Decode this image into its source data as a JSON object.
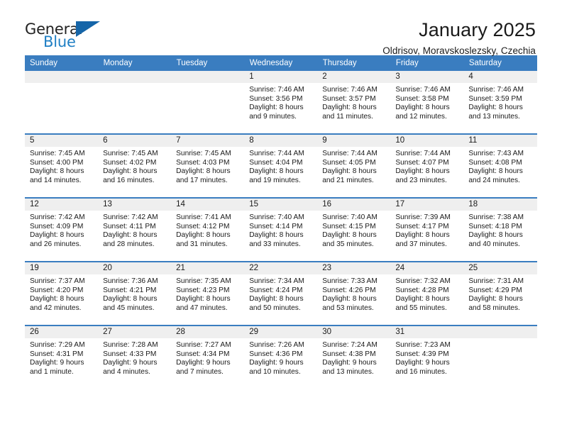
{
  "brand": {
    "name_top": "General",
    "name_bottom": "Blue",
    "accent_color": "#1f7fc4",
    "triangle_color": "#1565a8"
  },
  "header": {
    "title": "January 2025",
    "subtitle": "Oldrisov, Moravskoslezsky, Czechia"
  },
  "theme": {
    "header_row_bg": "#3a7dc0",
    "daynum_bg": "#efefef",
    "cell_bg": "#ffffff",
    "text_color": "#1a1a1a"
  },
  "weekday_headers": [
    "Sunday",
    "Monday",
    "Tuesday",
    "Wednesday",
    "Thursday",
    "Friday",
    "Saturday"
  ],
  "labels": {
    "sunrise_prefix": "Sunrise:",
    "sunset_prefix": "Sunset:",
    "daylight_prefix": "Daylight:"
  },
  "weeks": [
    [
      {
        "day": "",
        "empty": true
      },
      {
        "day": "",
        "empty": true
      },
      {
        "day": "",
        "empty": true
      },
      {
        "day": "1",
        "sunrise": "Sunrise: 7:46 AM",
        "sunset": "Sunset: 3:56 PM",
        "daylight_1": "Daylight: 8 hours",
        "daylight_2": "and 9 minutes."
      },
      {
        "day": "2",
        "sunrise": "Sunrise: 7:46 AM",
        "sunset": "Sunset: 3:57 PM",
        "daylight_1": "Daylight: 8 hours",
        "daylight_2": "and 11 minutes."
      },
      {
        "day": "3",
        "sunrise": "Sunrise: 7:46 AM",
        "sunset": "Sunset: 3:58 PM",
        "daylight_1": "Daylight: 8 hours",
        "daylight_2": "and 12 minutes."
      },
      {
        "day": "4",
        "sunrise": "Sunrise: 7:46 AM",
        "sunset": "Sunset: 3:59 PM",
        "daylight_1": "Daylight: 8 hours",
        "daylight_2": "and 13 minutes."
      }
    ],
    [
      {
        "day": "5",
        "sunrise": "Sunrise: 7:45 AM",
        "sunset": "Sunset: 4:00 PM",
        "daylight_1": "Daylight: 8 hours",
        "daylight_2": "and 14 minutes."
      },
      {
        "day": "6",
        "sunrise": "Sunrise: 7:45 AM",
        "sunset": "Sunset: 4:02 PM",
        "daylight_1": "Daylight: 8 hours",
        "daylight_2": "and 16 minutes."
      },
      {
        "day": "7",
        "sunrise": "Sunrise: 7:45 AM",
        "sunset": "Sunset: 4:03 PM",
        "daylight_1": "Daylight: 8 hours",
        "daylight_2": "and 17 minutes."
      },
      {
        "day": "8",
        "sunrise": "Sunrise: 7:44 AM",
        "sunset": "Sunset: 4:04 PM",
        "daylight_1": "Daylight: 8 hours",
        "daylight_2": "and 19 minutes."
      },
      {
        "day": "9",
        "sunrise": "Sunrise: 7:44 AM",
        "sunset": "Sunset: 4:05 PM",
        "daylight_1": "Daylight: 8 hours",
        "daylight_2": "and 21 minutes."
      },
      {
        "day": "10",
        "sunrise": "Sunrise: 7:44 AM",
        "sunset": "Sunset: 4:07 PM",
        "daylight_1": "Daylight: 8 hours",
        "daylight_2": "and 23 minutes."
      },
      {
        "day": "11",
        "sunrise": "Sunrise: 7:43 AM",
        "sunset": "Sunset: 4:08 PM",
        "daylight_1": "Daylight: 8 hours",
        "daylight_2": "and 24 minutes."
      }
    ],
    [
      {
        "day": "12",
        "sunrise": "Sunrise: 7:42 AM",
        "sunset": "Sunset: 4:09 PM",
        "daylight_1": "Daylight: 8 hours",
        "daylight_2": "and 26 minutes."
      },
      {
        "day": "13",
        "sunrise": "Sunrise: 7:42 AM",
        "sunset": "Sunset: 4:11 PM",
        "daylight_1": "Daylight: 8 hours",
        "daylight_2": "and 28 minutes."
      },
      {
        "day": "14",
        "sunrise": "Sunrise: 7:41 AM",
        "sunset": "Sunset: 4:12 PM",
        "daylight_1": "Daylight: 8 hours",
        "daylight_2": "and 31 minutes."
      },
      {
        "day": "15",
        "sunrise": "Sunrise: 7:40 AM",
        "sunset": "Sunset: 4:14 PM",
        "daylight_1": "Daylight: 8 hours",
        "daylight_2": "and 33 minutes."
      },
      {
        "day": "16",
        "sunrise": "Sunrise: 7:40 AM",
        "sunset": "Sunset: 4:15 PM",
        "daylight_1": "Daylight: 8 hours",
        "daylight_2": "and 35 minutes."
      },
      {
        "day": "17",
        "sunrise": "Sunrise: 7:39 AM",
        "sunset": "Sunset: 4:17 PM",
        "daylight_1": "Daylight: 8 hours",
        "daylight_2": "and 37 minutes."
      },
      {
        "day": "18",
        "sunrise": "Sunrise: 7:38 AM",
        "sunset": "Sunset: 4:18 PM",
        "daylight_1": "Daylight: 8 hours",
        "daylight_2": "and 40 minutes."
      }
    ],
    [
      {
        "day": "19",
        "sunrise": "Sunrise: 7:37 AM",
        "sunset": "Sunset: 4:20 PM",
        "daylight_1": "Daylight: 8 hours",
        "daylight_2": "and 42 minutes."
      },
      {
        "day": "20",
        "sunrise": "Sunrise: 7:36 AM",
        "sunset": "Sunset: 4:21 PM",
        "daylight_1": "Daylight: 8 hours",
        "daylight_2": "and 45 minutes."
      },
      {
        "day": "21",
        "sunrise": "Sunrise: 7:35 AM",
        "sunset": "Sunset: 4:23 PM",
        "daylight_1": "Daylight: 8 hours",
        "daylight_2": "and 47 minutes."
      },
      {
        "day": "22",
        "sunrise": "Sunrise: 7:34 AM",
        "sunset": "Sunset: 4:24 PM",
        "daylight_1": "Daylight: 8 hours",
        "daylight_2": "and 50 minutes."
      },
      {
        "day": "23",
        "sunrise": "Sunrise: 7:33 AM",
        "sunset": "Sunset: 4:26 PM",
        "daylight_1": "Daylight: 8 hours",
        "daylight_2": "and 53 minutes."
      },
      {
        "day": "24",
        "sunrise": "Sunrise: 7:32 AM",
        "sunset": "Sunset: 4:28 PM",
        "daylight_1": "Daylight: 8 hours",
        "daylight_2": "and 55 minutes."
      },
      {
        "day": "25",
        "sunrise": "Sunrise: 7:31 AM",
        "sunset": "Sunset: 4:29 PM",
        "daylight_1": "Daylight: 8 hours",
        "daylight_2": "and 58 minutes."
      }
    ],
    [
      {
        "day": "26",
        "sunrise": "Sunrise: 7:29 AM",
        "sunset": "Sunset: 4:31 PM",
        "daylight_1": "Daylight: 9 hours",
        "daylight_2": "and 1 minute."
      },
      {
        "day": "27",
        "sunrise": "Sunrise: 7:28 AM",
        "sunset": "Sunset: 4:33 PM",
        "daylight_1": "Daylight: 9 hours",
        "daylight_2": "and 4 minutes."
      },
      {
        "day": "28",
        "sunrise": "Sunrise: 7:27 AM",
        "sunset": "Sunset: 4:34 PM",
        "daylight_1": "Daylight: 9 hours",
        "daylight_2": "and 7 minutes."
      },
      {
        "day": "29",
        "sunrise": "Sunrise: 7:26 AM",
        "sunset": "Sunset: 4:36 PM",
        "daylight_1": "Daylight: 9 hours",
        "daylight_2": "and 10 minutes."
      },
      {
        "day": "30",
        "sunrise": "Sunrise: 7:24 AM",
        "sunset": "Sunset: 4:38 PM",
        "daylight_1": "Daylight: 9 hours",
        "daylight_2": "and 13 minutes."
      },
      {
        "day": "31",
        "sunrise": "Sunrise: 7:23 AM",
        "sunset": "Sunset: 4:39 PM",
        "daylight_1": "Daylight: 9 hours",
        "daylight_2": "and 16 minutes."
      },
      {
        "day": "",
        "empty": true
      }
    ]
  ]
}
